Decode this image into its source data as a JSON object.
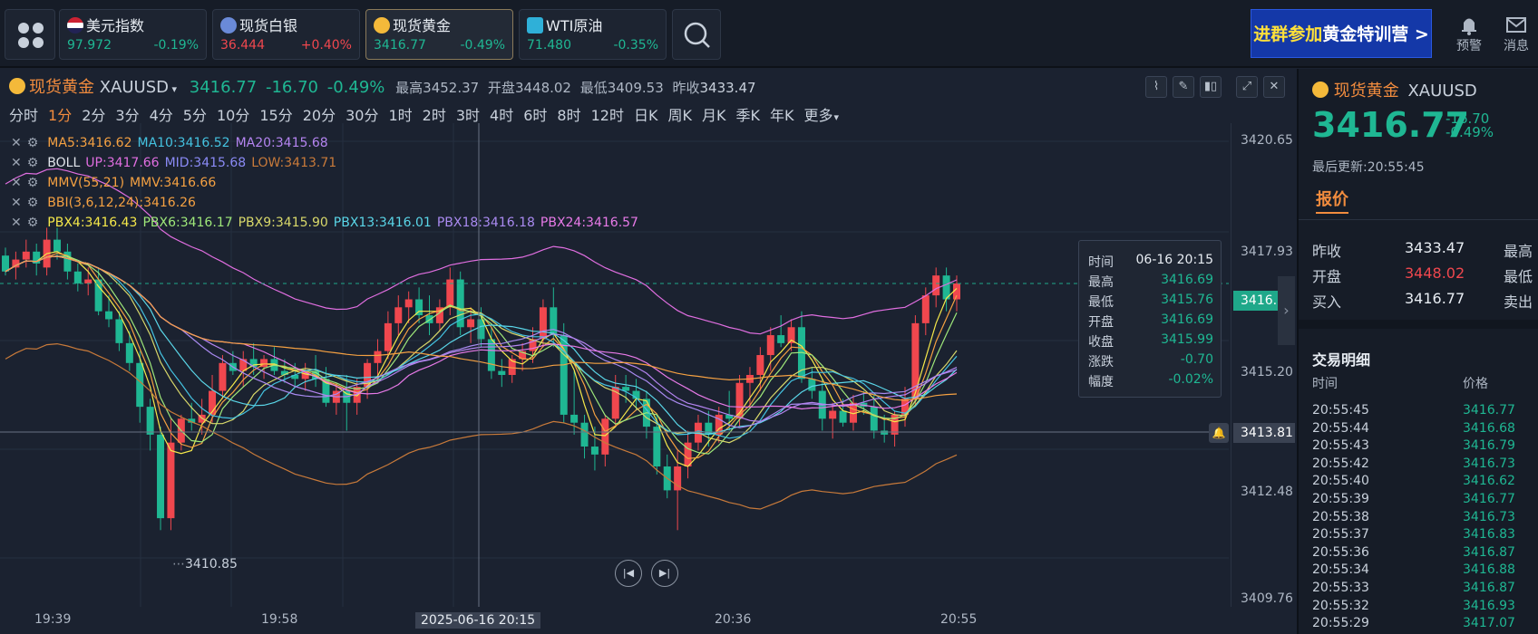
{
  "topbar": {
    "tickers": [
      {
        "name": "美元指数",
        "value": "97.972",
        "change": "-0.19%",
        "dir": "down",
        "icon": "us-flag-icon"
      },
      {
        "name": "现货白银",
        "value": "36.444",
        "change": "+0.40%",
        "dir": "up",
        "icon": "silver-icon"
      },
      {
        "name": "现货黄金",
        "value": "3416.77",
        "change": "-0.49%",
        "dir": "down",
        "icon": "gold-coin-icon"
      },
      {
        "name": "WTI原油",
        "value": "71.480",
        "change": "-0.35%",
        "dir": "down",
        "icon": "oil-icon"
      }
    ],
    "banner": {
      "highlight": "进群参加",
      "rest": "黄金特训营",
      "arrow": ">"
    },
    "alert_label": "预警",
    "message_label": "消息"
  },
  "chart_header": {
    "name": "现货黄金",
    "code": "XAUUSD",
    "price": "3416.77",
    "change": "-16.70",
    "change_pct": "-0.49%",
    "high_label": "最高",
    "high": "3452.37",
    "open_label": "开盘",
    "open": "3448.02",
    "low_label": "最低",
    "low": "3409.53",
    "prev_label": "昨收",
    "prev": "3433.47"
  },
  "timeframes": [
    "分时",
    "1分",
    "2分",
    "3分",
    "4分",
    "5分",
    "10分",
    "15分",
    "20分",
    "30分",
    "1时",
    "2时",
    "3时",
    "4时",
    "6时",
    "8时",
    "12时",
    "日K",
    "周K",
    "月K",
    "季K",
    "年K",
    "更多"
  ],
  "selected_timeframe": "1分",
  "indicators": {
    "ma": [
      {
        "text": "MA5:3416.62",
        "color": "#f5a142"
      },
      {
        "text": "MA10:3416.52",
        "color": "#44c2e0"
      },
      {
        "text": "MA20:3415.68",
        "color": "#b484f0"
      }
    ],
    "boll": [
      {
        "text": "BOLL",
        "color": "#e0e4ea"
      },
      {
        "text": "UP:3417.66",
        "color": "#e06ee0"
      },
      {
        "text": "MID:3415.68",
        "color": "#8a8af5"
      },
      {
        "text": "LOW:3413.71",
        "color": "#c87a3a"
      }
    ],
    "mmv": [
      {
        "text": "MMV(55,21)",
        "color": "#f5a142"
      },
      {
        "text": "MMV:3416.66",
        "color": "#f5a142"
      }
    ],
    "bbi": [
      {
        "text": "BBI(3,6,12,24):3416.26",
        "color": "#f5a142"
      }
    ],
    "pbx": [
      {
        "text": "PBX4:3416.43",
        "color": "#f5e84a"
      },
      {
        "text": "PBX6:3416.17",
        "color": "#9fe87a"
      },
      {
        "text": "PBX9:3415.90",
        "color": "#d8d86a"
      },
      {
        "text": "PBX13:3416.01",
        "color": "#5ad6e8"
      },
      {
        "text": "PBX18:3416.18",
        "color": "#a98af0"
      },
      {
        "text": "PBX24:3416.57",
        "color": "#e87ae8"
      }
    ]
  },
  "price_axis": [
    "3420.65",
    "3417.93",
    "3415.20",
    "3412.48",
    "3409.76"
  ],
  "current_price_tag": "3416.77",
  "crosshair_price_tag": "3413.81",
  "low_marker": "3410.85",
  "time_axis": [
    "19:39",
    "19:58",
    "2025-06-16 20:15",
    "20:36",
    "20:55"
  ],
  "tooltip": [
    {
      "label": "时间",
      "value": "06-16 20:15"
    },
    {
      "label": "最高",
      "value": "3416.69"
    },
    {
      "label": "最低",
      "value": "3415.76"
    },
    {
      "label": "开盘",
      "value": "3416.69"
    },
    {
      "label": "收盘",
      "value": "3415.99"
    },
    {
      "label": "涨跌",
      "value": "-0.70"
    },
    {
      "label": "幅度",
      "value": "-0.02%"
    }
  ],
  "colors": {
    "up": "#f0474e",
    "down": "#1fb793",
    "accent": "#f28c3e",
    "gold": "#f4b93a"
  },
  "chart_data": {
    "type": "candlestick",
    "yrange": [
      3409.3,
      3421.0
    ],
    "xlabels": [
      "19:39",
      "19:58",
      "20:15",
      "20:36",
      "20:55"
    ],
    "ohlc": [
      [
        3417.9,
        3418.1,
        3417.4,
        3417.5
      ],
      [
        3417.6,
        3418.0,
        3417.3,
        3417.8
      ],
      [
        3417.8,
        3418.3,
        3417.6,
        3418.0
      ],
      [
        3418.0,
        3418.2,
        3417.4,
        3417.7
      ],
      [
        3417.6,
        3418.6,
        3417.4,
        3418.3
      ],
      [
        3418.3,
        3418.6,
        3417.8,
        3418.0
      ],
      [
        3418.0,
        3418.2,
        3417.3,
        3417.5
      ],
      [
        3417.5,
        3417.7,
        3417.0,
        3417.2
      ],
      [
        3417.2,
        3417.6,
        3416.9,
        3417.3
      ],
      [
        3417.3,
        3417.6,
        3416.4,
        3416.5
      ],
      [
        3416.5,
        3416.9,
        3416.1,
        3416.3
      ],
      [
        3416.3,
        3416.5,
        3415.5,
        3415.7
      ],
      [
        3415.7,
        3416.0,
        3415.0,
        3415.2
      ],
      [
        3415.2,
        3415.5,
        3413.7,
        3414.1
      ],
      [
        3414.1,
        3414.3,
        3413.0,
        3413.4
      ],
      [
        3413.4,
        3413.6,
        3411.0,
        3411.3
      ],
      [
        3411.3,
        3413.8,
        3411.0,
        3413.2
      ],
      [
        3413.2,
        3413.9,
        3413.0,
        3413.8
      ],
      [
        3413.8,
        3414.2,
        3413.5,
        3413.7
      ],
      [
        3413.7,
        3414.3,
        3413.4,
        3413.9
      ],
      [
        3413.9,
        3414.9,
        3413.7,
        3414.5
      ],
      [
        3414.5,
        3415.4,
        3414.3,
        3415.2
      ],
      [
        3415.2,
        3415.5,
        3414.9,
        3415.0
      ],
      [
        3415.0,
        3415.5,
        3414.6,
        3415.3
      ],
      [
        3415.3,
        3415.7,
        3414.9,
        3415.1
      ],
      [
        3415.1,
        3415.4,
        3414.8,
        3415.3
      ],
      [
        3415.3,
        3415.6,
        3414.9,
        3415.0
      ],
      [
        3415.0,
        3415.3,
        3414.7,
        3414.9
      ],
      [
        3414.9,
        3415.2,
        3414.6,
        3414.8
      ],
      [
        3414.8,
        3415.2,
        3414.5,
        3415.0
      ],
      [
        3415.0,
        3415.4,
        3414.6,
        3414.8
      ],
      [
        3414.8,
        3415.1,
        3414.1,
        3414.2
      ],
      [
        3414.2,
        3414.7,
        3413.9,
        3414.5
      ],
      [
        3414.5,
        3414.9,
        3413.5,
        3414.2
      ],
      [
        3414.2,
        3414.8,
        3413.9,
        3414.6
      ],
      [
        3414.6,
        3415.3,
        3414.3,
        3415.2
      ],
      [
        3415.2,
        3415.8,
        3414.9,
        3415.5
      ],
      [
        3415.5,
        3416.5,
        3415.3,
        3416.2
      ],
      [
        3416.2,
        3416.9,
        3415.9,
        3416.6
      ],
      [
        3416.6,
        3417.0,
        3416.2,
        3416.8
      ],
      [
        3416.8,
        3417.1,
        3416.2,
        3416.4
      ],
      [
        3416.4,
        3416.9,
        3415.9,
        3416.2
      ],
      [
        3416.2,
        3416.8,
        3416.0,
        3416.6
      ],
      [
        3416.6,
        3417.6,
        3416.4,
        3417.3
      ],
      [
        3417.3,
        3417.5,
        3415.9,
        3416.1
      ],
      [
        3416.1,
        3416.6,
        3415.7,
        3416.3
      ],
      [
        3416.3,
        3416.6,
        3415.6,
        3415.8
      ],
      [
        3415.8,
        3416.1,
        3414.8,
        3415.0
      ],
      [
        3415.0,
        3415.3,
        3414.6,
        3414.9
      ],
      [
        3414.9,
        3415.4,
        3414.7,
        3415.3
      ],
      [
        3415.3,
        3415.7,
        3415.0,
        3415.5
      ],
      [
        3415.5,
        3416.1,
        3415.2,
        3415.8
      ],
      [
        3415.8,
        3416.8,
        3415.6,
        3416.6
      ],
      [
        3416.6,
        3417.1,
        3415.6,
        3415.9
      ],
      [
        3415.9,
        3416.2,
        3413.7,
        3413.9
      ],
      [
        3413.9,
        3415.0,
        3413.4,
        3413.7
      ],
      [
        3413.7,
        3413.9,
        3412.8,
        3413.1
      ],
      [
        3413.1,
        3413.6,
        3412.5,
        3412.9
      ],
      [
        3412.9,
        3413.9,
        3412.6,
        3413.8
      ],
      [
        3413.8,
        3414.9,
        3413.6,
        3414.6
      ],
      [
        3414.6,
        3414.9,
        3414.2,
        3414.5
      ],
      [
        3414.5,
        3414.8,
        3414.0,
        3414.3
      ],
      [
        3414.3,
        3414.5,
        3413.3,
        3413.6
      ],
      [
        3413.6,
        3413.9,
        3412.4,
        3412.6
      ],
      [
        3412.6,
        3412.9,
        3411.8,
        3412.0
      ],
      [
        3412.0,
        3413.0,
        3411.0,
        3412.6
      ],
      [
        3412.6,
        3413.5,
        3412.3,
        3413.2
      ],
      [
        3413.2,
        3413.9,
        3413.0,
        3413.7
      ],
      [
        3413.7,
        3414.0,
        3413.1,
        3413.4
      ],
      [
        3413.4,
        3414.1,
        3413.2,
        3413.9
      ],
      [
        3413.9,
        3414.5,
        3413.5,
        3413.8
      ],
      [
        3413.8,
        3414.9,
        3413.6,
        3414.7
      ],
      [
        3414.7,
        3415.1,
        3414.1,
        3414.9
      ],
      [
        3414.9,
        3415.6,
        3414.5,
        3415.4
      ],
      [
        3415.4,
        3416.1,
        3415.0,
        3415.9
      ],
      [
        3415.9,
        3416.4,
        3415.6,
        3415.7
      ],
      [
        3415.7,
        3416.3,
        3415.5,
        3416.1
      ],
      [
        3416.1,
        3416.5,
        3414.7,
        3414.8
      ],
      [
        3414.8,
        3415.1,
        3414.3,
        3414.5
      ],
      [
        3414.5,
        3414.8,
        3413.5,
        3413.8
      ],
      [
        3413.8,
        3414.2,
        3413.3,
        3414.0
      ],
      [
        3414.0,
        3414.3,
        3413.6,
        3413.7
      ],
      [
        3413.7,
        3414.4,
        3413.5,
        3414.2
      ],
      [
        3414.2,
        3414.5,
        3413.9,
        3414.1
      ],
      [
        3414.1,
        3414.4,
        3413.3,
        3413.5
      ],
      [
        3413.5,
        3413.9,
        3413.2,
        3413.4
      ],
      [
        3413.4,
        3414.0,
        3413.1,
        3413.9
      ],
      [
        3413.9,
        3414.6,
        3413.6,
        3414.3
      ],
      [
        3414.3,
        3416.4,
        3414.1,
        3416.2
      ],
      [
        3416.2,
        3417.1,
        3415.9,
        3416.9
      ],
      [
        3416.9,
        3417.6,
        3416.6,
        3417.4
      ],
      [
        3417.4,
        3417.6,
        3416.5,
        3416.8
      ],
      [
        3416.8,
        3417.4,
        3416.5,
        3417.2
      ]
    ]
  },
  "right_panel": {
    "name": "现货黄金",
    "code": "XAUUSD",
    "price": "3416.77",
    "change": "-16.70",
    "change_pct": "-0.49%",
    "update_label": "最后更新:",
    "update_time": "20:55:45",
    "tab": "报价",
    "quote_rows": [
      {
        "label": "昨收",
        "value": "3433.47",
        "right_label": "最高",
        "color": "#e7ecf2"
      },
      {
        "label": "开盘",
        "value": "3448.02",
        "right_label": "最低",
        "color": "#f0474e"
      },
      {
        "label": "买入",
        "value": "3416.77",
        "right_label": "卖出",
        "color": "#e7ecf2"
      }
    ],
    "trades_title": "交易明细",
    "trades_col_time": "时间",
    "trades_col_price": "价格",
    "trades": [
      {
        "time": "20:55:45",
        "price": "3416.77"
      },
      {
        "time": "20:55:44",
        "price": "3416.68"
      },
      {
        "time": "20:55:43",
        "price": "3416.79"
      },
      {
        "time": "20:55:42",
        "price": "3416.73"
      },
      {
        "time": "20:55:40",
        "price": "3416.62"
      },
      {
        "time": "20:55:39",
        "price": "3416.77"
      },
      {
        "time": "20:55:38",
        "price": "3416.73"
      },
      {
        "time": "20:55:37",
        "price": "3416.83"
      },
      {
        "time": "20:55:36",
        "price": "3416.87"
      },
      {
        "time": "20:55:34",
        "price": "3416.88"
      },
      {
        "time": "20:55:33",
        "price": "3416.87"
      },
      {
        "time": "20:55:32",
        "price": "3416.93"
      },
      {
        "time": "20:55:29",
        "price": "3417.07"
      }
    ]
  }
}
